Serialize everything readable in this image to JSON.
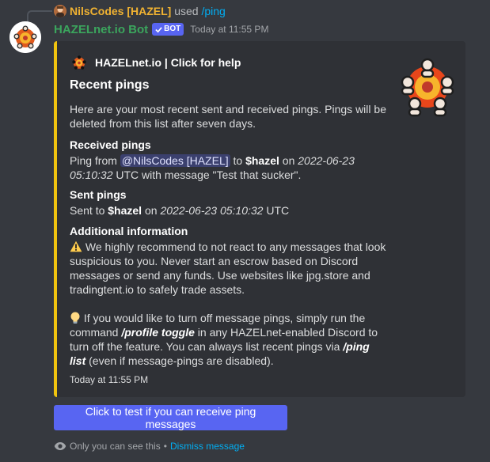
{
  "reply": {
    "user": "NilsCodes [HAZEL]",
    "used_text": "used",
    "command": "/ping"
  },
  "message": {
    "author": "HAZELnet.io Bot",
    "tag": "BOT",
    "timestamp": "Today at 11:55 PM"
  },
  "embed": {
    "accent_color": "#f1c40f",
    "author": "HAZELnet.io | Click for help",
    "title": "Recent pings",
    "description": "Here are your most recent sent and received pings. Pings will be deleted from this list after seven days.",
    "received": {
      "name": "Received pings",
      "prefix": "Ping from ",
      "mention": "@NilsCodes [HAZEL]",
      "to": " to ",
      "target": "$hazel",
      "on": " on ",
      "date": "2022-06-23 05:10:32",
      "suffix": " UTC with message \"Test that sucker\"."
    },
    "sent": {
      "name": "Sent pings",
      "prefix": "Sent to ",
      "target": "$hazel",
      "on": " on ",
      "date": "2022-06-23 05:10:32",
      "suffix": " UTC"
    },
    "additional": {
      "name": "Additional information",
      "warning": " We highly recommend to not react to any messages that look suspicious to you. Never start an escrow based on Discord messages or send any funds. Use websites like jpg.store and tradingtent.io to safely trade assets.",
      "tip_a": " If you would like to turn off message pings, simply run the command ",
      "tip_cmd1": "/profile toggle",
      "tip_b": " in any HAZELnet-enabled Discord to turn off the feature. You can always list recent pings via ",
      "tip_cmd2": "/ping list",
      "tip_c": " (even if message-pings are disabled)."
    },
    "footer": "Today at 11:55 PM"
  },
  "button": {
    "label": "Click to test if you can receive ping messages",
    "color": "#5865f2"
  },
  "ephemeral": {
    "text": "Only you can see this",
    "separator": "•",
    "dismiss": "Dismiss message"
  },
  "icons": {
    "reply_avatar": "user-avatar-icon",
    "bot_avatar": "hazelnet-logo-icon",
    "verified": "checkmark-icon",
    "warning": "warning-icon",
    "bulb": "lightbulb-icon",
    "eye": "eye-icon"
  }
}
